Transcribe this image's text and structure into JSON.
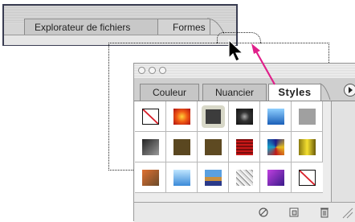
{
  "top_panel": {
    "tabs": [
      {
        "label": "Explorateur de fichiers"
      },
      {
        "label": "Formes"
      }
    ]
  },
  "palette": {
    "tabs": [
      {
        "label": "Couleur",
        "active": false
      },
      {
        "label": "Nuancier",
        "active": false
      },
      {
        "label": "Styles",
        "active": true
      }
    ],
    "styles_rows": [
      [
        "none",
        "red-glow",
        "gray-rounded",
        "dark-sphere",
        "blue-gradient",
        "gray-flat"
      ],
      [
        "black-gradient",
        "brown",
        "brown",
        "red-stripes",
        "colorful-blocks",
        "yellow-chrome"
      ],
      [
        "orange-brown",
        "blue-light",
        "landscape",
        "gray-texture",
        "purple",
        "none"
      ]
    ],
    "footer_icons": [
      "no-style-icon",
      "new-style-icon",
      "trash-icon"
    ]
  },
  "colors": {
    "pink_arrow": "#e0208a",
    "cursor": "#000000",
    "none_slash": "#d8202a",
    "frame_border": "#3a3d52"
  }
}
